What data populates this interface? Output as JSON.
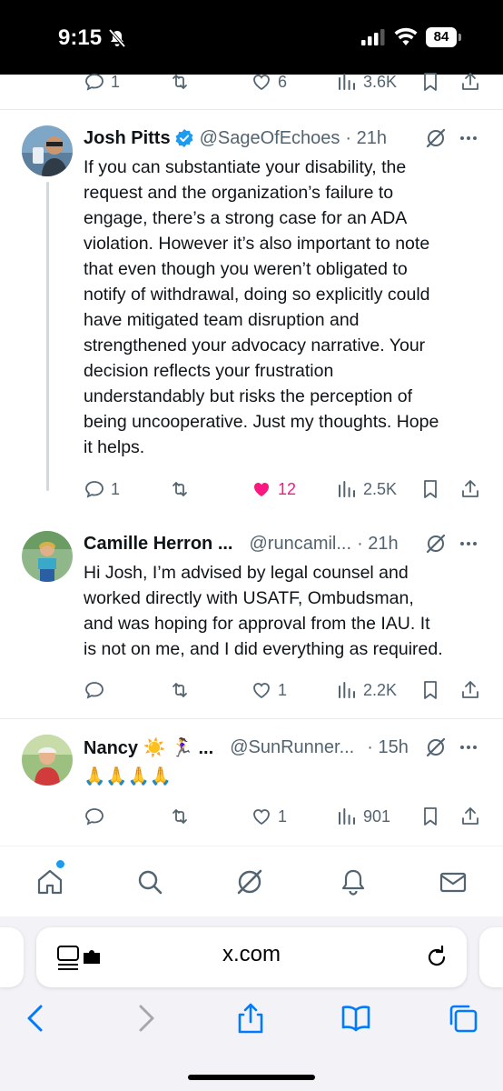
{
  "status_bar": {
    "time": "9:15",
    "battery": "84"
  },
  "tweets": [
    {
      "stats": {
        "replies": "1",
        "likes": "6",
        "views": "3.6K"
      }
    },
    {
      "name": "Josh Pitts",
      "handle": "@SageOfEchoes",
      "time": "· 21h",
      "verified": true,
      "text": "If you can substantiate your disability, the\nrequest and the organization’s failure to\nengage, there’s a strong case for an ADA\nviolation. However it’s also important to note\nthat even though you weren’t obligated to\nnotify of withdrawal, doing so explicitly could\nhave mitigated team disruption and\nstrengthened your advocacy narrative. Your\ndecision reflects your frustration\nunderstandably but risks the perception of\nbeing uncooperative. Just my thoughts. Hope\nit helps.",
      "stats": {
        "replies": "1",
        "likes": "12",
        "views": "2.5K",
        "liked": true
      }
    },
    {
      "name": "Camille Herron ...",
      "handle": "@runcamil...",
      "time": "· 21h",
      "text": "Hi Josh, I’m advised by legal counsel and\nworked directly with USATF, Ombudsman,\nand was hoping for approval from the IAU. It\nis not on me, and I did everything as required.",
      "stats": {
        "replies": "",
        "likes": "1",
        "views": "2.2K"
      }
    },
    {
      "name": "Nancy ☀️ 🏃‍♀️ ...",
      "handle": "@SunRunner...",
      "time": "· 15h",
      "text": "🙏🙏🙏🙏",
      "stats": {
        "replies": "",
        "likes": "1",
        "views": "901"
      }
    }
  ],
  "browser": {
    "url": "x.com"
  },
  "colors": {
    "like": "#f91880",
    "verified": "#1d9bf0",
    "secondary": "#536471",
    "ios_blue": "#007aff"
  },
  "icons": [
    "reply-icon",
    "retweet-icon",
    "like-icon",
    "views-icon",
    "bookmark-icon",
    "share-icon",
    "grok-icon",
    "more-icon",
    "home-icon",
    "search-icon",
    "bell-icon",
    "mail-icon",
    "back-icon",
    "forward-icon",
    "bookmarks-icon",
    "tabs-icon",
    "reload-icon"
  ]
}
